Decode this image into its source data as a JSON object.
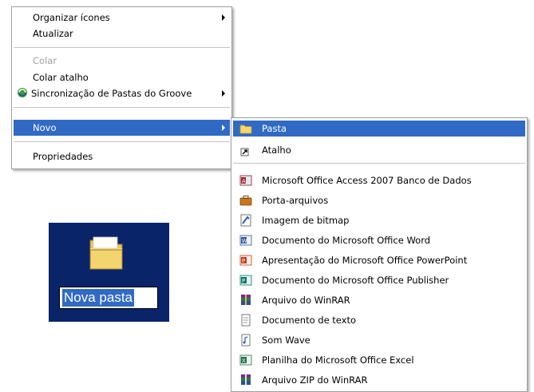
{
  "context_menu": {
    "items": [
      {
        "label": "Organizar ícones",
        "submenu": true
      },
      {
        "label": "Atualizar"
      },
      {
        "label": "Colar",
        "disabled": true
      },
      {
        "label": "Colar atalho"
      },
      {
        "label": "Sincronização de Pastas do Groove",
        "submenu": true,
        "icon": "groove-sync-icon"
      },
      {
        "label": "Novo",
        "submenu": true,
        "highlighted": true
      },
      {
        "label": "Propriedades"
      }
    ]
  },
  "new_submenu": {
    "items": [
      {
        "label": "Pasta",
        "icon": "folder-icon",
        "highlighted": true
      },
      {
        "label": "Atalho",
        "icon": "shortcut-icon"
      },
      {
        "label": "Microsoft Office Access 2007 Banco de Dados",
        "icon": "access-icon"
      },
      {
        "label": "Porta-arquivos",
        "icon": "briefcase-icon"
      },
      {
        "label": "Imagem de bitmap",
        "icon": "bitmap-icon"
      },
      {
        "label": "Documento do Microsoft Office Word",
        "icon": "word-icon"
      },
      {
        "label": "Apresentação do Microsoft Office PowerPoint",
        "icon": "powerpoint-icon"
      },
      {
        "label": "Documento do Microsoft Office Publisher",
        "icon": "publisher-icon"
      },
      {
        "label": "Arquivo do WinRAR",
        "icon": "winrar-icon"
      },
      {
        "label": "Documento de texto",
        "icon": "text-document-icon"
      },
      {
        "label": "Som Wave",
        "icon": "wave-sound-icon"
      },
      {
        "label": "Planilha do Microsoft Office Excel",
        "icon": "excel-icon"
      },
      {
        "label": "Arquivo ZIP do WinRAR",
        "icon": "winrar-zip-icon"
      }
    ]
  },
  "desktop_folder": {
    "name_value": "Nova pasta",
    "icon": "folder-icon"
  },
  "colors": {
    "highlight": "#316ac5",
    "desktop_selection": "#0a246a",
    "folder": "#f5d76e",
    "disabled_text": "#a0a0a0"
  }
}
